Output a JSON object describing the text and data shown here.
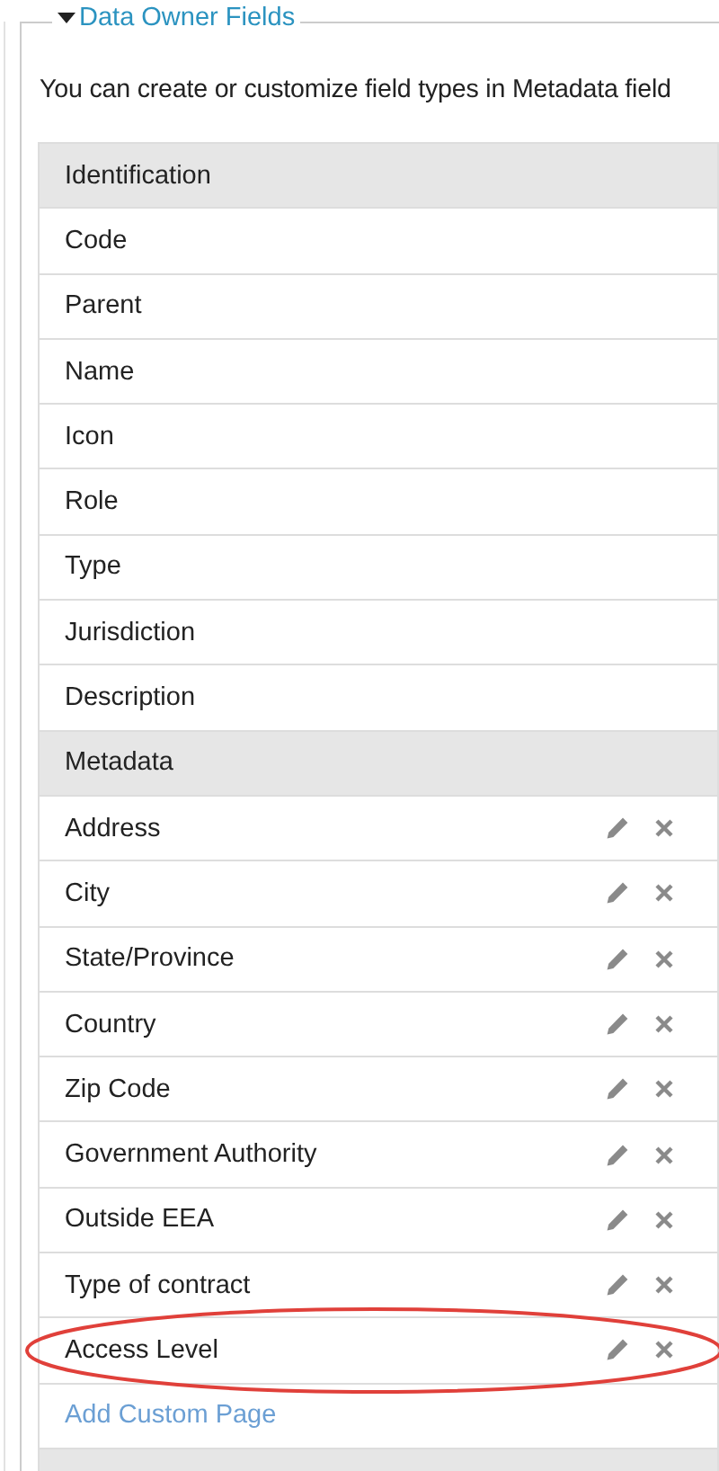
{
  "panel": {
    "title": "Data Owner Fields",
    "expanded": true
  },
  "description": "You can create or customize field types in Metadata field",
  "sections": [
    {
      "title": "Identification",
      "fields": [
        {
          "label": "Code",
          "editable": false,
          "highlighted": false
        },
        {
          "label": "Parent",
          "editable": false,
          "highlighted": false
        },
        {
          "label": "Name",
          "editable": false,
          "highlighted": false
        },
        {
          "label": "Icon",
          "editable": false,
          "highlighted": false
        },
        {
          "label": "Role",
          "editable": false,
          "highlighted": false
        },
        {
          "label": "Type",
          "editable": false,
          "highlighted": false
        },
        {
          "label": "Jurisdiction",
          "editable": false,
          "highlighted": false
        },
        {
          "label": "Description",
          "editable": false,
          "highlighted": false
        }
      ]
    },
    {
      "title": "Metadata",
      "fields": [
        {
          "label": "Address",
          "editable": true,
          "highlighted": false
        },
        {
          "label": "City",
          "editable": true,
          "highlighted": false
        },
        {
          "label": "State/Province",
          "editable": true,
          "highlighted": false
        },
        {
          "label": "Country",
          "editable": true,
          "highlighted": false
        },
        {
          "label": "Zip Code",
          "editable": true,
          "highlighted": false
        },
        {
          "label": "Government Authority",
          "editable": true,
          "highlighted": false
        },
        {
          "label": "Outside EEA",
          "editable": true,
          "highlighted": false
        },
        {
          "label": "Type of contract",
          "editable": true,
          "highlighted": false
        },
        {
          "label": "Access Level",
          "editable": true,
          "highlighted": true
        }
      ],
      "add_link": "Add Custom Page"
    }
  ]
}
